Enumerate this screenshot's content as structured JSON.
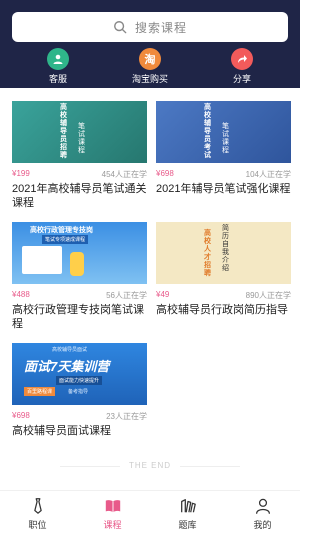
{
  "search": {
    "placeholder": "搜索课程"
  },
  "quick_actions": [
    {
      "label": "客服",
      "icon": "customer-service-icon",
      "color": "#2fb58a"
    },
    {
      "label": "淘宝购买",
      "icon": "taobao-icon",
      "color": "#f08a3c",
      "glyph": "淘"
    },
    {
      "label": "分享",
      "icon": "share-icon",
      "color": "#f25b5b"
    }
  ],
  "courses": [
    {
      "price": "¥199",
      "learners": "454人正在学",
      "title": "2021年高校辅导员笔试通关课程",
      "thumb_text": [
        "高校辅导员招聘",
        "笔试课程"
      ],
      "thumb_color": "#2f8f88"
    },
    {
      "price": "¥698",
      "learners": "104人正在学",
      "title": "2021年辅导员笔试强化课程",
      "thumb_text": [
        "高校辅导员考试",
        "笔试课程"
      ],
      "thumb_color": "#3a66b0"
    },
    {
      "price": "¥488",
      "learners": "56人正在学",
      "title": "高校行政管理专技岗笔试课程",
      "thumb_text": [
        "高校行政管理专技岗",
        "笔试专项速成课程"
      ],
      "thumb_color": "#2f7fd6"
    },
    {
      "price": "¥49",
      "learners": "890人正在学",
      "title": "高校辅导员行政岗简历指导",
      "thumb_text": [
        "高校人才招聘",
        "简历自我介绍"
      ],
      "thumb_color": "#f3e6bf"
    },
    {
      "price": "¥698",
      "learners": "23人正在学",
      "title": "高校辅导员面试课程",
      "thumb_text": [
        "高校辅导员面试",
        "面试7天集训营",
        "面试能力快速提升",
        "百里路程课",
        "备考指导"
      ],
      "thumb_color": "#2b7fd9"
    }
  ],
  "footer": {
    "the_end": "THE END"
  },
  "tabs": [
    {
      "label": "职位",
      "icon": "tie-icon",
      "active": false
    },
    {
      "label": "课程",
      "icon": "book-icon",
      "active": true
    },
    {
      "label": "题库",
      "icon": "question-bank-icon",
      "active": false
    },
    {
      "label": "我的",
      "icon": "user-icon",
      "active": false
    }
  ],
  "colors": {
    "header_bg": "#1f2547",
    "accent_pink": "#e85a8a",
    "muted": "#999999"
  }
}
